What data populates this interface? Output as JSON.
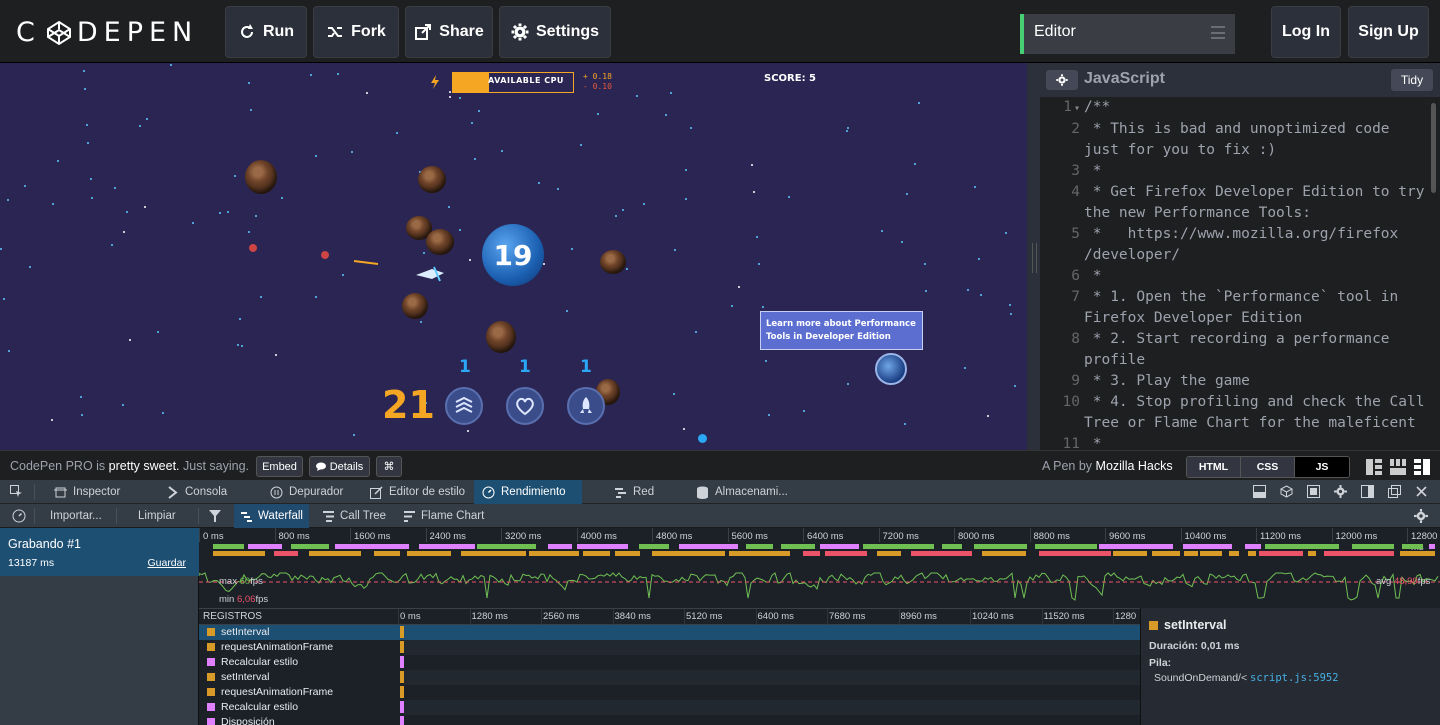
{
  "topbar": {
    "logo": "C DEPEN",
    "buttons": {
      "run": "Run",
      "fork": "Fork",
      "share": "Share",
      "settings": "Settings"
    },
    "editor_selector": "Editor",
    "login": "Log In",
    "signup": "Sign Up"
  },
  "game": {
    "cpu_label": "AVAILABLE CPU",
    "cpu_delta_pos": "+ 0.18",
    "cpu_delta_neg": "- 0.10",
    "cpu_fraction": 0.3,
    "score": "SCORE: 5",
    "planet_number": "19",
    "big_count": "21",
    "powerups": [
      {
        "count": "1",
        "icon": "shield-chevrons-icon"
      },
      {
        "count": "1",
        "icon": "heart-icon"
      },
      {
        "count": "1",
        "icon": "rocket-icon"
      }
    ],
    "tooltip": "Learn more about Performance Tools in Developer Edition"
  },
  "editor": {
    "title": "JavaScript",
    "tidy": "Tidy",
    "lines": [
      {
        "n": "1",
        "text": "/**",
        "fold": true
      },
      {
        "n": "2",
        "text": " * This is bad and unoptimized code"
      },
      {
        "n": "",
        "text": "just for you to fix :)"
      },
      {
        "n": "3",
        "text": " *"
      },
      {
        "n": "4",
        "text": " * Get Firefox Developer Edition to try"
      },
      {
        "n": "",
        "text": "the new Performance Tools:"
      },
      {
        "n": "5",
        "text": " *   https://www.mozilla.org/firefox"
      },
      {
        "n": "",
        "text": "/developer/"
      },
      {
        "n": "6",
        "text": " *"
      },
      {
        "n": "7",
        "text": " * 1. Open the `Performance` tool in"
      },
      {
        "n": "",
        "text": "Firefox Developer Edition"
      },
      {
        "n": "8",
        "text": " * 2. Start recording a performance"
      },
      {
        "n": "",
        "text": "profile"
      },
      {
        "n": "9",
        "text": " * 3. Play the game"
      },
      {
        "n": "10",
        "text": " * 4. Stop profiling and check the Call"
      },
      {
        "n": "",
        "text": "Tree or Flame Chart for the maleficent"
      },
      {
        "n": "11",
        "text": " *"
      }
    ]
  },
  "footer": {
    "pro_prefix": "CodePen PRO is",
    "pro_bold": "pretty sweet.",
    "pro_suffix": "Just saying.",
    "embed": "Embed",
    "details": "Details",
    "cmd": "⌘",
    "pen_by": "A Pen by",
    "author": "Mozilla Hacks",
    "langs": [
      "HTML",
      "CSS",
      "JS"
    ]
  },
  "devtools": {
    "tabs": [
      "Inspector",
      "Consola",
      "Depurador",
      "Editor de estilo",
      "Rendimiento",
      "Red",
      "Almacenami..."
    ],
    "toolbar": {
      "import": "Importar...",
      "clear": "Limpiar",
      "waterfall": "Waterfall",
      "calltree": "Call Tree",
      "flame": "Flame Chart"
    },
    "recording": {
      "title": "Grabando #1",
      "ms": "13187 ms",
      "save": "Guardar"
    },
    "overview_ticks": [
      "0 ms",
      "800 ms",
      "1600 ms",
      "2400 ms",
      "3200 ms",
      "4000 ms",
      "4800 ms",
      "5600 ms",
      "6400 ms",
      "7200 ms",
      "8000 ms",
      "8800 ms",
      "9600 ms",
      "10400 ms",
      "11200 ms",
      "12000 ms",
      "12800 ms"
    ],
    "fps": {
      "max_label": "max",
      "max": "60",
      "min_label": "min",
      "min": "6,06",
      "avg_label": "avg",
      "avg": "48,99",
      "unit": "fps"
    },
    "registros_title": "REGISTROS",
    "registros_ticks": [
      "0 ms",
      "1280 ms",
      "2560 ms",
      "3840 ms",
      "5120 ms",
      "6400 ms",
      "7680 ms",
      "8960 ms",
      "10240 ms",
      "11520 ms",
      "1280"
    ],
    "records": [
      {
        "name": "setInterval",
        "color": "#d99b28"
      },
      {
        "name": "requestAnimationFrame",
        "color": "#d99b28"
      },
      {
        "name": "Recalcular estilo",
        "color": "#df80ff"
      },
      {
        "name": "setInterval",
        "color": "#d99b28"
      },
      {
        "name": "requestAnimationFrame",
        "color": "#d99b28"
      },
      {
        "name": "Recalcular estilo",
        "color": "#df80ff"
      },
      {
        "name": "Disposición",
        "color": "#df80ff"
      }
    ],
    "detail": {
      "title": "setInterval",
      "duration": "Duración: 0,01 ms",
      "stack_label": "Pila:",
      "stack_fn": "SoundOnDemand/<",
      "stack_link": "script.js:5952"
    }
  },
  "colors": {
    "accent_green": "#47cf73",
    "selected_blue": "#1d4f73",
    "js_orange": "#d99b28",
    "css_purple": "#df80ff",
    "fps_green": "#70bf53"
  }
}
